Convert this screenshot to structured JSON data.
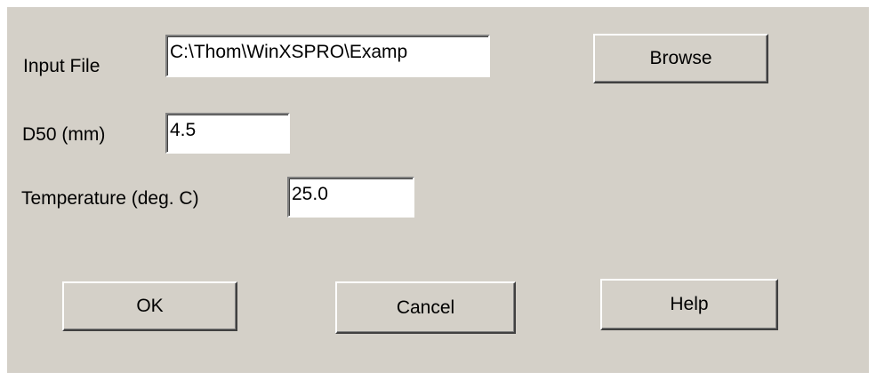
{
  "dialog": {
    "input_file": {
      "label": "Input File",
      "value": "C:\\Thom\\WinXSPRO\\Examp"
    },
    "d50": {
      "label": "D50 (mm)",
      "value": "4.5"
    },
    "temperature": {
      "label": "Temperature (deg. C)",
      "value": "25.0"
    },
    "buttons": {
      "browse": "Browse",
      "ok": "OK",
      "cancel": "Cancel",
      "help": "Help"
    }
  },
  "colors": {
    "dialog_background": "#d4d0c8",
    "field_background": "#ffffff",
    "text": "#000000"
  }
}
